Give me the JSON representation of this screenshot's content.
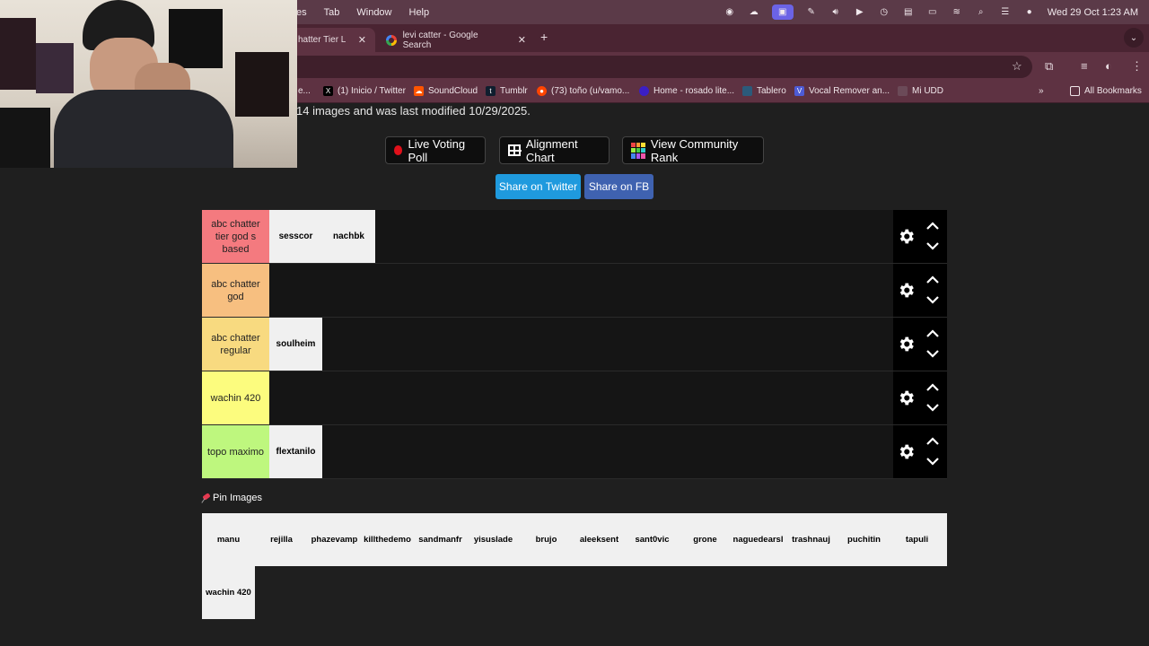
{
  "menubar": {
    "menus": [
      "es",
      "Tab",
      "Window",
      "Help"
    ],
    "clock": "Wed 29 Oct  1:23 AM"
  },
  "tabs": [
    {
      "label": "hatter Tier List",
      "active": true
    },
    {
      "label": "levi catter - Google Search",
      "active": false
    }
  ],
  "bookmarks": [
    {
      "label": "e...",
      "icon": "generic"
    },
    {
      "label": "(1) Inicio / Twitter",
      "icon": "x"
    },
    {
      "label": "SoundCloud",
      "icon": "soundcloud"
    },
    {
      "label": "Tumblr",
      "icon": "tumblr"
    },
    {
      "label": "(73) toño (u/vamo...",
      "icon": "reddit"
    },
    {
      "label": "Home - rosado lite...",
      "icon": "generic"
    },
    {
      "label": "Tablero",
      "icon": "generic"
    },
    {
      "label": "Vocal Remover an...",
      "icon": "v"
    },
    {
      "label": "Mi UDD",
      "icon": "generic"
    }
  ],
  "all_bookmarks": "All Bookmarks",
  "page": {
    "description": "14 images and was last modified 10/29/2025.",
    "buttons": {
      "live_voting": "Live Voting Poll",
      "alignment": "Alignment Chart",
      "community": "View Community Rank",
      "share_twitter": "Share on Twitter",
      "share_fb": "Share on FB"
    },
    "tiers": [
      {
        "label": "abc chatter tier god s based",
        "color": "#f47a7f",
        "items": [
          "sesscor",
          "nachbk"
        ]
      },
      {
        "label": "abc chatter god",
        "color": "#f7bf80",
        "items": []
      },
      {
        "label": "abc chatter regular",
        "color": "#f8da80",
        "items": [
          "soulheim"
        ]
      },
      {
        "label": "wachin 420",
        "color": "#fcfc7e",
        "items": []
      },
      {
        "label": "topo maximo",
        "color": "#bef77e",
        "items": [
          "flextanilo"
        ]
      }
    ],
    "pin_images": "Pin Images",
    "pool": [
      "manu",
      "rejilla",
      "phazevamp",
      "killthedemo",
      "sandmanfr",
      "yisuslade",
      "brujo",
      "aleeksent",
      "sant0vic",
      "grone",
      "naguedearsl",
      "trashnauj",
      "puchitin",
      "tapuli",
      "wachin 420"
    ]
  }
}
